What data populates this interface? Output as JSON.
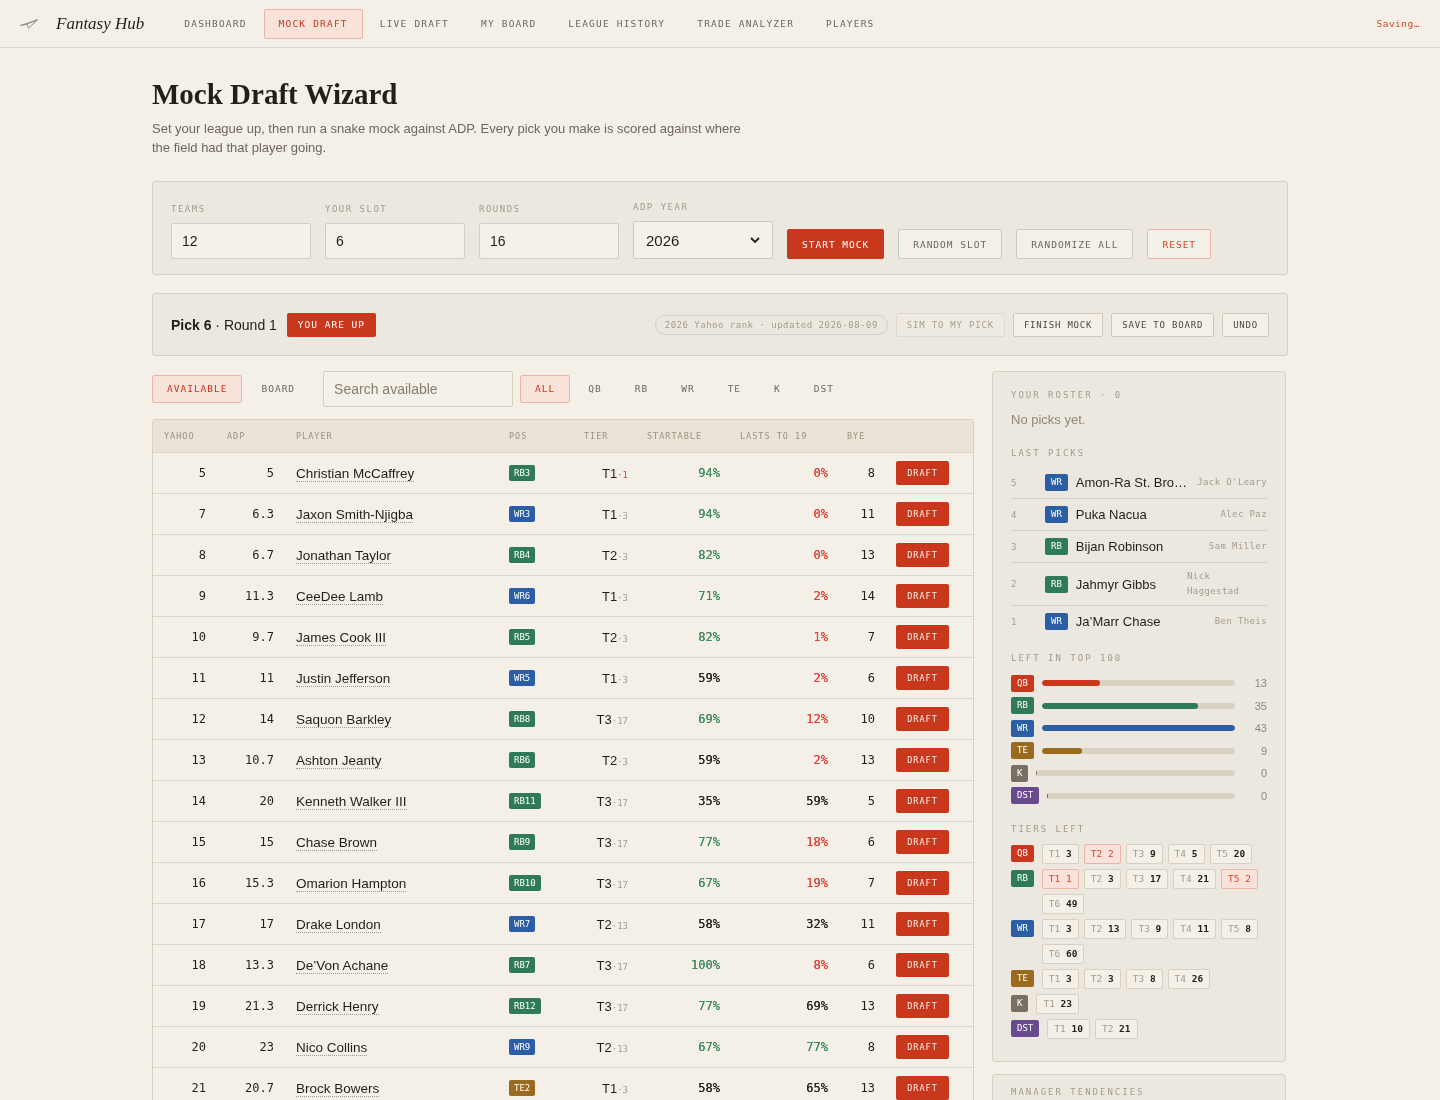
{
  "nav": {
    "brand": "Fantasy Hub",
    "items": [
      {
        "label": "DASHBOARD",
        "selected": false
      },
      {
        "label": "MOCK DRAFT",
        "selected": true
      },
      {
        "label": "LIVE DRAFT",
        "selected": false
      },
      {
        "label": "MY BOARD",
        "selected": false
      },
      {
        "label": "LEAGUE HISTORY",
        "selected": false
      },
      {
        "label": "TRADE ANALYZER",
        "selected": false
      },
      {
        "label": "PLAYERS",
        "selected": false
      }
    ],
    "status": "Saving…"
  },
  "header": {
    "title": "Mock Draft Wizard",
    "subtitle": "Set your league up, then run a snake mock against ADP. Every pick you make is scored against where the field had that player going."
  },
  "setup": {
    "fields": [
      {
        "label": "TEAMS",
        "value": "12",
        "kind": "input"
      },
      {
        "label": "YOUR SLOT",
        "value": "6",
        "kind": "input"
      },
      {
        "label": "ROUNDS",
        "value": "16",
        "kind": "input"
      },
      {
        "label": "ADP YEAR",
        "value": "2026",
        "kind": "select"
      }
    ],
    "buttons": [
      {
        "label": "START MOCK",
        "kind": "primary"
      },
      {
        "label": "RANDOM SLOT",
        "kind": "default"
      },
      {
        "label": "RANDOMIZE ALL",
        "kind": "default"
      },
      {
        "label": "RESET",
        "kind": "danger"
      }
    ]
  },
  "pick_bar": {
    "pick": "**Pick 6** · Round 1",
    "badge": "YOU ARE UP",
    "source": "2026 Yahoo rank · updated 2026-08-09",
    "buttons": [
      {
        "label": "SIM TO MY PICK",
        "disabled": true
      },
      {
        "label": "FINISH MOCK",
        "disabled": false
      },
      {
        "label": "SAVE TO BOARD",
        "disabled": false
      },
      {
        "label": "UNDO",
        "disabled": false
      }
    ]
  },
  "views": [
    {
      "label": "AVAILABLE",
      "selected": true
    },
    {
      "label": "BOARD",
      "selected": false
    }
  ],
  "search": {
    "placeholder": "Search available"
  },
  "filters": [
    {
      "label": "ALL",
      "selected": true
    },
    {
      "label": "QB",
      "selected": false
    },
    {
      "label": "RB",
      "selected": false
    },
    {
      "label": "WR",
      "selected": false
    },
    {
      "label": "TE",
      "selected": false
    },
    {
      "label": "K",
      "selected": false
    },
    {
      "label": "DST",
      "selected": false
    }
  ],
  "table": {
    "columns": [
      "YAHOO",
      "ADP",
      "PLAYER",
      "POS",
      "TIER",
      "STARTABLE",
      "LASTS TO 19",
      "BYE"
    ],
    "rows": [
      {
        "yahoo": "5",
        "adp": "5",
        "player": "Christian McCaffrey",
        "pos": {
          "text": "RB3",
          "color": "#2f7b57"
        },
        "tier": "T1",
        "tier_left": "·1",
        "tier_scarce": true,
        "startable": {
          "text": "94%",
          "color": "#3f8c5f"
        },
        "lasts": {
          "text": "0%",
          "color": "#e0453a"
        },
        "bye": "8",
        "action": "DRAFT"
      },
      {
        "yahoo": "7",
        "adp": "6.3",
        "player": "Jaxon Smith-Njigba",
        "pos": {
          "text": "WR3",
          "color": "#2b5ea4"
        },
        "tier": "T1",
        "tier_left": "·3",
        "tier_scarce": false,
        "startable": {
          "text": "94%",
          "color": "#3f8c5f"
        },
        "lasts": {
          "text": "0%",
          "color": "#e0453a"
        },
        "bye": "11",
        "action": "DRAFT"
      },
      {
        "yahoo": "8",
        "adp": "6.7",
        "player": "Jonathan Taylor",
        "pos": {
          "text": "RB4",
          "color": "#2f7b57"
        },
        "tier": "T2",
        "tier_left": "·3",
        "tier_scarce": false,
        "startable": {
          "text": "82%",
          "color": "#3f8c5f"
        },
        "lasts": {
          "text": "0%",
          "color": "#e0453a"
        },
        "bye": "13",
        "action": "DRAFT"
      },
      {
        "yahoo": "9",
        "adp": "11.3",
        "player": "CeeDee Lamb",
        "pos": {
          "text": "WR6",
          "color": "#2b5ea4"
        },
        "tier": "T1",
        "tier_left": "·3",
        "tier_scarce": false,
        "startable": {
          "text": "71%",
          "color": "#3f8c5f"
        },
        "lasts": {
          "text": "2%",
          "color": "#e0453a"
        },
        "bye": "14",
        "action": "DRAFT"
      },
      {
        "yahoo": "10",
        "adp": "9.7",
        "player": "James Cook III",
        "pos": {
          "text": "RB5",
          "color": "#2f7b57"
        },
        "tier": "T2",
        "tier_left": "·3",
        "tier_scarce": false,
        "startable": {
          "text": "82%",
          "color": "#3f8c5f"
        },
        "lasts": {
          "text": "1%",
          "color": "#e0453a"
        },
        "bye": "7",
        "action": "DRAFT"
      },
      {
        "yahoo": "11",
        "adp": "11",
        "player": "Justin Jefferson",
        "pos": {
          "text": "WR5",
          "color": "#2b5ea4"
        },
        "tier": "T1",
        "tier_left": "·3",
        "tier_scarce": false,
        "startable": {
          "text": "59%",
          "color": "#2a2520"
        },
        "lasts": {
          "text": "2%",
          "color": "#e0453a"
        },
        "bye": "6",
        "action": "DRAFT"
      },
      {
        "yahoo": "12",
        "adp": "14",
        "player": "Saquon Barkley",
        "pos": {
          "text": "RB8",
          "color": "#2f7b57"
        },
        "tier": "T3",
        "tier_left": "·17",
        "tier_scarce": false,
        "startable": {
          "text": "69%",
          "color": "#3f8c5f"
        },
        "lasts": {
          "text": "12%",
          "color": "#e0453a"
        },
        "bye": "10",
        "action": "DRAFT"
      },
      {
        "yahoo": "13",
        "adp": "10.7",
        "player": "Ashton Jeanty",
        "pos": {
          "text": "RB6",
          "color": "#2f7b57"
        },
        "tier": "T2",
        "tier_left": "·3",
        "tier_scarce": false,
        "startable": {
          "text": "59%",
          "color": "#2a2520"
        },
        "lasts": {
          "text": "2%",
          "color": "#e0453a"
        },
        "bye": "13",
        "action": "DRAFT"
      },
      {
        "yahoo": "14",
        "adp": "20",
        "player": "Kenneth Walker III",
        "pos": {
          "text": "RB11",
          "color": "#2f7b57"
        },
        "tier": "T3",
        "tier_left": "·17",
        "tier_scarce": false,
        "startable": {
          "text": "35%",
          "color": "#2a2520"
        },
        "lasts": {
          "text": "59%",
          "color": "#2a2520"
        },
        "bye": "5",
        "action": "DRAFT"
      },
      {
        "yahoo": "15",
        "adp": "15",
        "player": "Chase Brown",
        "pos": {
          "text": "RB9",
          "color": "#2f7b57"
        },
        "tier": "T3",
        "tier_left": "·17",
        "tier_scarce": false,
        "startable": {
          "text": "77%",
          "color": "#3f8c5f"
        },
        "lasts": {
          "text": "18%",
          "color": "#e0453a"
        },
        "bye": "6",
        "action": "DRAFT"
      },
      {
        "yahoo": "16",
        "adp": "15.3",
        "player": "Omarion Hampton",
        "pos": {
          "text": "RB10",
          "color": "#2f7b57"
        },
        "tier": "T3",
        "tier_left": "·17",
        "tier_scarce": false,
        "startable": {
          "text": "67%",
          "color": "#3f8c5f"
        },
        "lasts": {
          "text": "19%",
          "color": "#e0453a"
        },
        "bye": "7",
        "action": "DRAFT"
      },
      {
        "yahoo": "17",
        "adp": "17",
        "player": "Drake London",
        "pos": {
          "text": "WR7",
          "color": "#2b5ea4"
        },
        "tier": "T2",
        "tier_left": "·13",
        "tier_scarce": false,
        "startable": {
          "text": "58%",
          "color": "#2a2520"
        },
        "lasts": {
          "text": "32%",
          "color": "#2a2520"
        },
        "bye": "11",
        "action": "DRAFT"
      },
      {
        "yahoo": "18",
        "adp": "13.3",
        "player": "De’Von Achane",
        "pos": {
          "text": "RB7",
          "color": "#2f7b57"
        },
        "tier": "T3",
        "tier_left": "·17",
        "tier_scarce": false,
        "startable": {
          "text": "100%",
          "color": "#3f8c5f"
        },
        "lasts": {
          "text": "8%",
          "color": "#e0453a"
        },
        "bye": "6",
        "action": "DRAFT"
      },
      {
        "yahoo": "19",
        "adp": "21.3",
        "player": "Derrick Henry",
        "pos": {
          "text": "RB12",
          "color": "#2f7b57"
        },
        "tier": "T3",
        "tier_left": "·17",
        "tier_scarce": false,
        "startable": {
          "text": "77%",
          "color": "#3f8c5f"
        },
        "lasts": {
          "text": "69%",
          "color": "#2a2520"
        },
        "bye": "13",
        "action": "DRAFT"
      },
      {
        "yahoo": "20",
        "adp": "23",
        "player": "Nico Collins",
        "pos": {
          "text": "WR9",
          "color": "#2b5ea4"
        },
        "tier": "T2",
        "tier_left": "·13",
        "tier_scarce": false,
        "startable": {
          "text": "67%",
          "color": "#3f8c5f"
        },
        "lasts": {
          "text": "77%",
          "color": "#3f8c5f"
        },
        "bye": "8",
        "action": "DRAFT"
      },
      {
        "yahoo": "21",
        "adp": "20.7",
        "player": "Brock Bowers",
        "pos": {
          "text": "TE2",
          "color": "#9a6a1f"
        },
        "tier": "T1",
        "tier_left": "·3",
        "tier_scarce": false,
        "startable": {
          "text": "58%",
          "color": "#2a2520"
        },
        "lasts": {
          "text": "65%",
          "color": "#2a2520"
        },
        "bye": "13",
        "action": "DRAFT"
      }
    ]
  },
  "sidebar": {
    "roster": {
      "title": "YOUR ROSTER · 0",
      "empty": "No picks yet."
    },
    "last_picks": {
      "title": "LAST PICKS",
      "items": [
        {
          "no": "5",
          "pos": {
            "text": "WR",
            "color": "#2b5ea4"
          },
          "player": "Amon-Ra St. Bro…",
          "manager": "Jack O'Leary"
        },
        {
          "no": "4",
          "pos": {
            "text": "WR",
            "color": "#2b5ea4"
          },
          "player": "Puka Nacua",
          "manager": "Alec Paz"
        },
        {
          "no": "3",
          "pos": {
            "text": "RB",
            "color": "#2f7b57"
          },
          "player": "Bijan Robinson",
          "manager": "Sam Miller"
        },
        {
          "no": "2",
          "pos": {
            "text": "RB",
            "color": "#2f7b57"
          },
          "player": "Jahmyr Gibbs",
          "manager": "Nick Haggestad"
        },
        {
          "no": "1",
          "pos": {
            "text": "WR",
            "color": "#2b5ea4"
          },
          "player": "Ja’Marr Chase",
          "manager": "Ben Theis"
        }
      ]
    },
    "left_top100": {
      "title": "LEFT IN TOP 100",
      "items": [
        {
          "pos": {
            "text": "QB",
            "color": "#c9381d"
          },
          "level": 0.3,
          "count": "13"
        },
        {
          "pos": {
            "text": "RB",
            "color": "#2f7b57"
          },
          "level": 0.81,
          "count": "35"
        },
        {
          "pos": {
            "text": "WR",
            "color": "#2b5ea4"
          },
          "level": 1,
          "count": "43"
        },
        {
          "pos": {
            "text": "TE",
            "color": "#9a6a1f"
          },
          "level": 0.21,
          "count": "9"
        },
        {
          "pos": {
            "text": "K",
            "color": "#786f62"
          },
          "level": 0,
          "count": "0"
        },
        {
          "pos": {
            "text": "DST",
            "color": "#6a4a8e"
          },
          "level": 0,
          "count": "0"
        }
      ]
    },
    "tiers_left": {
      "title": "TIERS LEFT",
      "groups": [
        {
          "pos": {
            "text": "QB",
            "color": "#c9381d"
          },
          "tiers": [
            {
              "tier": "T1",
              "count": "3",
              "scarce": false
            },
            {
              "tier": "T2",
              "count": "2",
              "scarce": true
            },
            {
              "tier": "T3",
              "count": "9",
              "scarce": false
            },
            {
              "tier": "T4",
              "count": "5",
              "scarce": false
            },
            {
              "tier": "T5",
              "count": "20",
              "scarce": false
            }
          ]
        },
        {
          "pos": {
            "text": "RB",
            "color": "#2f7b57"
          },
          "tiers": [
            {
              "tier": "T1",
              "count": "1",
              "scarce": true
            },
            {
              "tier": "T2",
              "count": "3",
              "scarce": false
            },
            {
              "tier": "T3",
              "count": "17",
              "scarce": false
            },
            {
              "tier": "T4",
              "count": "21",
              "scarce": false
            },
            {
              "tier": "T5",
              "count": "2",
              "scarce": true
            },
            {
              "tier": "T6",
              "count": "49",
              "scarce": false
            }
          ]
        },
        {
          "pos": {
            "text": "WR",
            "color": "#2b5ea4"
          },
          "tiers": [
            {
              "tier": "T1",
              "count": "3",
              "scarce": false
            },
            {
              "tier": "T2",
              "count": "13",
              "scarce": false
            },
            {
              "tier": "T3",
              "count": "9",
              "scarce": false
            },
            {
              "tier": "T4",
              "count": "11",
              "scarce": false
            },
            {
              "tier": "T5",
              "count": "8",
              "scarce": false
            },
            {
              "tier": "T6",
              "count": "60",
              "scarce": false
            }
          ]
        },
        {
          "pos": {
            "text": "TE",
            "color": "#9a6a1f"
          },
          "tiers": [
            {
              "tier": "T1",
              "count": "3",
              "scarce": false
            },
            {
              "tier": "T2",
              "count": "3",
              "scarce": false
            },
            {
              "tier": "T3",
              "count": "8",
              "scarce": false
            },
            {
              "tier": "T4",
              "count": "26",
              "scarce": false
            }
          ]
        },
        {
          "pos": {
            "text": "K",
            "color": "#786f62"
          },
          "tiers": [
            {
              "tier": "T1",
              "count": "23",
              "scarce": false
            }
          ]
        },
        {
          "pos": {
            "text": "DST",
            "color": "#6a4a8e"
          },
          "tiers": [
            {
              "tier": "T1",
              "count": "10",
              "scarce": false
            },
            {
              "tier": "T2",
              "count": "21",
              "scarce": false
            }
          ]
        }
      ]
    },
    "manager_tendencies": {
      "title": "MANAGER TENDENCIES"
    }
  }
}
